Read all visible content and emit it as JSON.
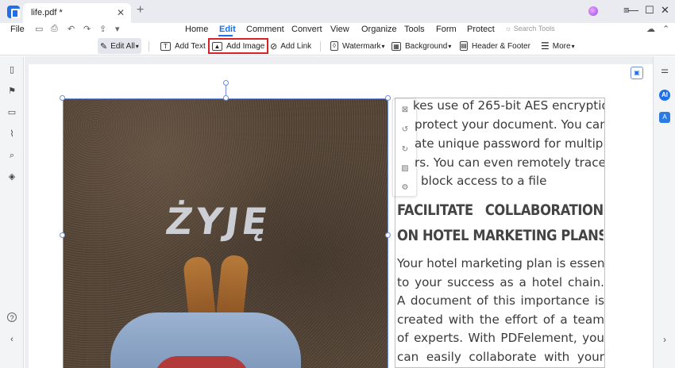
{
  "window": {
    "tab_title": "life.pdf *",
    "tab_close": "✕",
    "tab_add": "+",
    "minimize": "—",
    "maximize": "☐",
    "close": "✕"
  },
  "menu": {
    "file": "File",
    "items": [
      "Home",
      "Edit",
      "Comment",
      "Convert",
      "View",
      "Organize",
      "Tools",
      "Form",
      "Protect"
    ],
    "active": "Edit",
    "search_placeholder": "Search Tools"
  },
  "toolbar": {
    "edit_all": "Edit All",
    "add_text": "Add Text",
    "add_image": "Add Image",
    "add_link": "Add Link",
    "watermark": "Watermark",
    "background": "Background",
    "header_footer": "Header & Footer",
    "more": "More"
  },
  "document": {
    "photo_text": "ŻYJĘ",
    "paragraph1": [
      "kes use of 265-bit AES encryption",
      "protect your document. You can",
      "ate unique password for multiple",
      "rs. You can even remotely trace",
      "block access to a file."
    ],
    "heading": [
      "FACILITATE COLLABORATION",
      "ON HOTEL MARKETING PLANS"
    ],
    "paragraph2": [
      "Your hotel marketing plan is essential",
      "to your success as a hotel chain.",
      "A document of this importance is",
      "created with the effort of a team",
      "of experts. With PDFelement, you",
      "can easily collaborate with your"
    ]
  },
  "colors": {
    "accent": "#1f6fe8",
    "highlight_border": "#d8222a"
  }
}
